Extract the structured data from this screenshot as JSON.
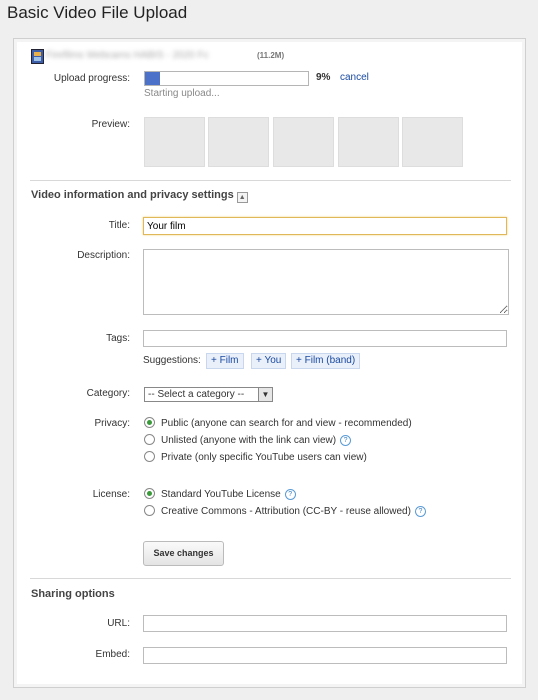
{
  "page": {
    "title": "Basic Video File Upload"
  },
  "upload": {
    "filename": "Firefilms Webcams HABIS - 2020 Fc",
    "filesize": "11.2M",
    "progress_label": "Upload progress:",
    "progress_percent": 9,
    "progress_text": "9%",
    "cancel_label": "cancel",
    "status": "Starting upload...",
    "preview_label": "Preview:",
    "preview_thumbs": 5
  },
  "video_info": {
    "heading": "Video information and privacy settings",
    "title_label": "Title:",
    "title_value": "Your film",
    "description_label": "Description:",
    "description_value": "",
    "tags_label": "Tags:",
    "tags_value": "",
    "suggestions_label": "Suggestions:",
    "suggestions": [
      "+ Film",
      "+ You",
      "+ Film (band)"
    ],
    "category_label": "Category:",
    "category_selected": "-- Select a category --",
    "privacy_label": "Privacy:",
    "privacy_options": [
      "Public (anyone can search for and view - recommended)",
      "Unlisted (anyone with the link can view)",
      "Private (only specific YouTube users can view)"
    ],
    "privacy_selected": 0,
    "license_label": "License:",
    "license_options": [
      "Standard YouTube License",
      "Creative Commons - Attribution (CC-BY - reuse allowed)"
    ],
    "license_selected": 0,
    "save_label": "Save changes"
  },
  "sharing": {
    "heading": "Sharing options",
    "url_label": "URL:",
    "url_value": "",
    "embed_label": "Embed:",
    "embed_value": ""
  },
  "colors": {
    "accent": "#4b72c8",
    "link": "#1a4aa0",
    "radio_on": "#3a9a3a"
  }
}
